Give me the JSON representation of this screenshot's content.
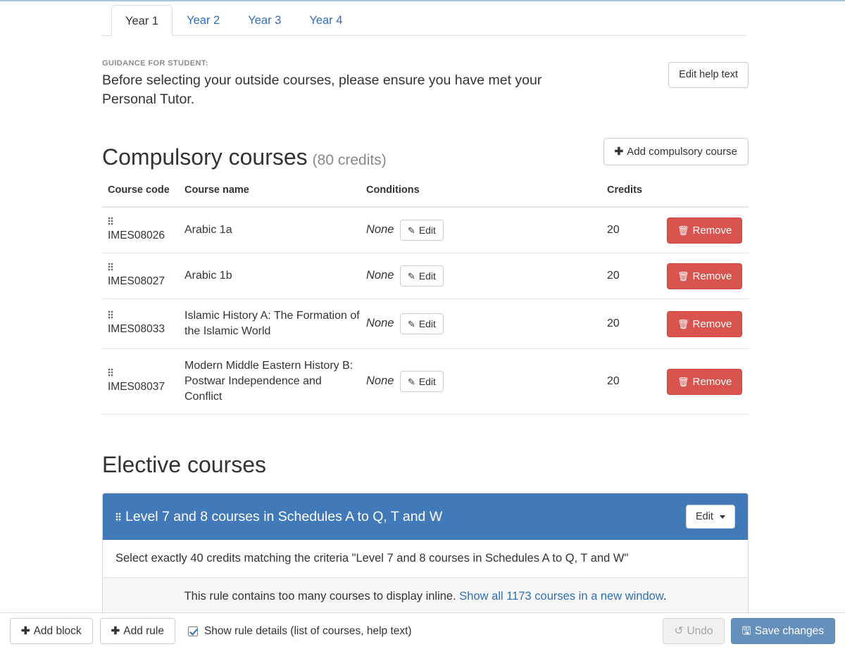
{
  "tabs": [
    {
      "label": "Year 1",
      "active": true
    },
    {
      "label": "Year 2",
      "active": false
    },
    {
      "label": "Year 3",
      "active": false
    },
    {
      "label": "Year 4",
      "active": false
    }
  ],
  "guidance": {
    "label": "GUIDANCE FOR STUDENT:",
    "text": "Before selecting your outside courses, please ensure you have met your Personal Tutor.",
    "edit_button": "Edit help text"
  },
  "compulsory": {
    "title": "Compulsory courses",
    "credits_note": "(80 credits)",
    "add_button": "Add compulsory course",
    "add_icon": "plus-icon",
    "columns": [
      "Course code",
      "Course name",
      "Conditions",
      "Credits",
      ""
    ],
    "rows": [
      {
        "drag_icon": "drag-handle-icon",
        "code": "IMES08026",
        "name": "Arabic 1a",
        "condition": "None",
        "edit_label": "Edit",
        "edit_icon": "pencil-icon",
        "credits": "20",
        "remove_label": "Remove",
        "remove_icon": "trash-icon"
      },
      {
        "drag_icon": "drag-handle-icon",
        "code": "IMES08027",
        "name": "Arabic 1b",
        "condition": "None",
        "edit_label": "Edit",
        "edit_icon": "pencil-icon",
        "credits": "20",
        "remove_label": "Remove",
        "remove_icon": "trash-icon"
      },
      {
        "drag_icon": "drag-handle-icon",
        "code": "IMES08033",
        "name": "Islamic History A: The Formation of the Islamic World",
        "condition": "None",
        "edit_label": "Edit",
        "edit_icon": "pencil-icon",
        "credits": "20",
        "remove_label": "Remove",
        "remove_icon": "trash-icon"
      },
      {
        "drag_icon": "drag-handle-icon",
        "code": "IMES08037",
        "name": "Modern Middle Eastern History B: Postwar Independence and Conflict",
        "condition": "None",
        "edit_label": "Edit",
        "edit_icon": "pencil-icon",
        "credits": "20",
        "remove_label": "Remove",
        "remove_icon": "trash-icon"
      }
    ]
  },
  "elective": {
    "title": "Elective courses",
    "rule": {
      "drag_icon": "drag-handle-icon",
      "heading": "Level 7 and 8 courses in Schedules A to Q, T and W",
      "edit_label": "Edit",
      "edit_caret_icon": "caret-down-icon",
      "description": "Select exactly 40 credits matching the criteria \"Level 7 and 8 courses in Schedules A to Q, T and W\"",
      "note_prefix": "This rule contains too many courses to display inline.",
      "note_link": "Show all 1173 courses in a new window",
      "note_suffix": "."
    }
  },
  "footer": {
    "add_block": "Add block",
    "add_rule": "Add rule",
    "add_icon": "plus-icon",
    "checkbox_label": "Show rule details (list of courses, help text)",
    "checkbox_checked": true,
    "undo": "Undo",
    "undo_icon": "undo-icon",
    "save": "Save changes",
    "save_icon": "floppy-disk-icon"
  },
  "colors": {
    "accent_blue": "#4279b8",
    "link_blue": "#2f6fb5",
    "danger_red": "#d9534f",
    "save_blue": "#6590bc"
  }
}
